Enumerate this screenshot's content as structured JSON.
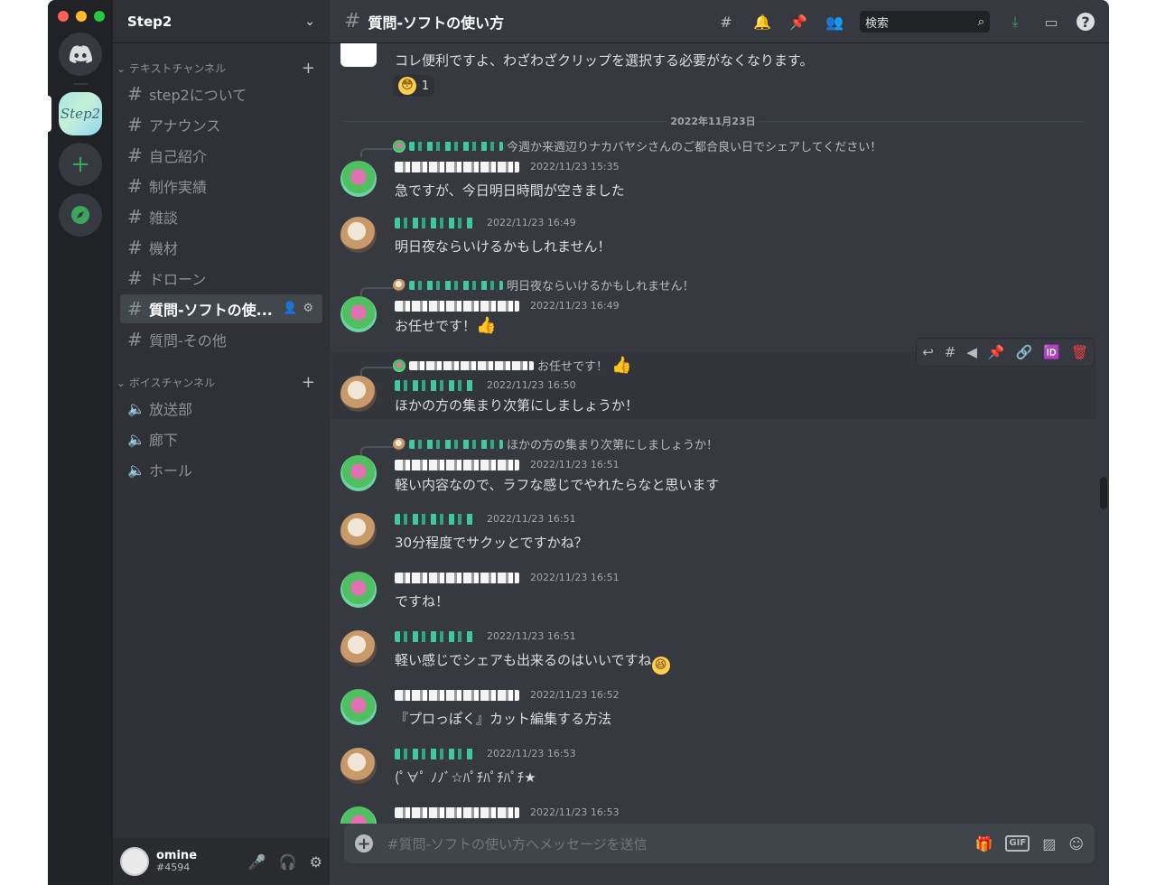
{
  "window": {
    "controls": [
      "close",
      "minimize",
      "maximize"
    ]
  },
  "rail": {
    "servers": [
      {
        "name": "home",
        "icon": "discord-icon"
      },
      {
        "name": "Step2",
        "label": "Step2"
      },
      {
        "name": "add-server",
        "icon": "plus-icon"
      },
      {
        "name": "explore",
        "icon": "compass-icon"
      }
    ]
  },
  "guild": {
    "name": "Step2"
  },
  "sidebar": {
    "text_category": "テキストチャンネル",
    "text_channels": [
      {
        "name": "step2について"
      },
      {
        "name": "アナウンス"
      },
      {
        "name": "自己紹介"
      },
      {
        "name": "制作実績"
      },
      {
        "name": "雑談"
      },
      {
        "name": "機材"
      },
      {
        "name": "ドローン"
      },
      {
        "name": "質問-ソフトの使...",
        "active": true
      },
      {
        "name": "質問-その他"
      }
    ],
    "voice_category": "ボイスチャンネル",
    "voice_channels": [
      {
        "name": "放送部"
      },
      {
        "name": "廊下"
      },
      {
        "name": "ホール"
      }
    ]
  },
  "user": {
    "name": "omine",
    "tag": "#4594"
  },
  "channel": {
    "title": "質問-ソフトの使い方"
  },
  "search": {
    "placeholder": "検索"
  },
  "messages": {
    "first": {
      "text": "コレ便利ですよ、わざわざクリップを選択する必要がなくなります。",
      "reaction_count": "1"
    },
    "date_divider": "2022年11月23日",
    "items": [
      {
        "reply_to": "今週か来週辺りナカバヤシさんのご都合良い日でシェアしてください！",
        "time": "2022/11/23 15:35",
        "text": "急ですが、今日明日時間が空きました"
      },
      {
        "time": "2022/11/23 16:49",
        "text": "明日夜ならいけるかもしれません！"
      },
      {
        "reply_to": "明日夜ならいけるかもしれません！",
        "time": "2022/11/23 16:49",
        "text": "お任せです！"
      },
      {
        "reply_to": "お任せです！",
        "time": "2022/11/23 16:50",
        "text": "ほかの方の集まり次第にしましょうか！"
      },
      {
        "reply_to": "ほかの方の集まり次第にしましょうか！",
        "time": "2022/11/23 16:51",
        "text": "軽い内容なので、ラフな感じでやれたらなと思います"
      },
      {
        "time": "2022/11/23 16:51",
        "text": "30分程度でサクッとですかね？"
      },
      {
        "time": "2022/11/23 16:51",
        "text": "ですね！"
      },
      {
        "time": "2022/11/23 16:51",
        "text": "軽い感じでシェアも出来るのはいいですね"
      },
      {
        "time": "2022/11/23 16:52",
        "text": "『プロっぽく』カット編集する方法"
      },
      {
        "time": "2022/11/23 16:53",
        "text": "(ﾟ∀ﾟ ﾉﾉﾞ☆ﾊﾟﾁﾊﾟﾁﾊﾟﾁ★"
      },
      {
        "time": "2022/11/23 16:53",
        "text": ""
      }
    ]
  },
  "composer": {
    "placeholder": "#質問-ソフトの使い方へメッセージを送信",
    "gif_label": "GIF"
  },
  "colors": {
    "background": "#36393f",
    "sidebar": "#2f3136",
    "rail": "#202225",
    "accent_green": "#3ba55d",
    "danger": "#ed4245"
  }
}
